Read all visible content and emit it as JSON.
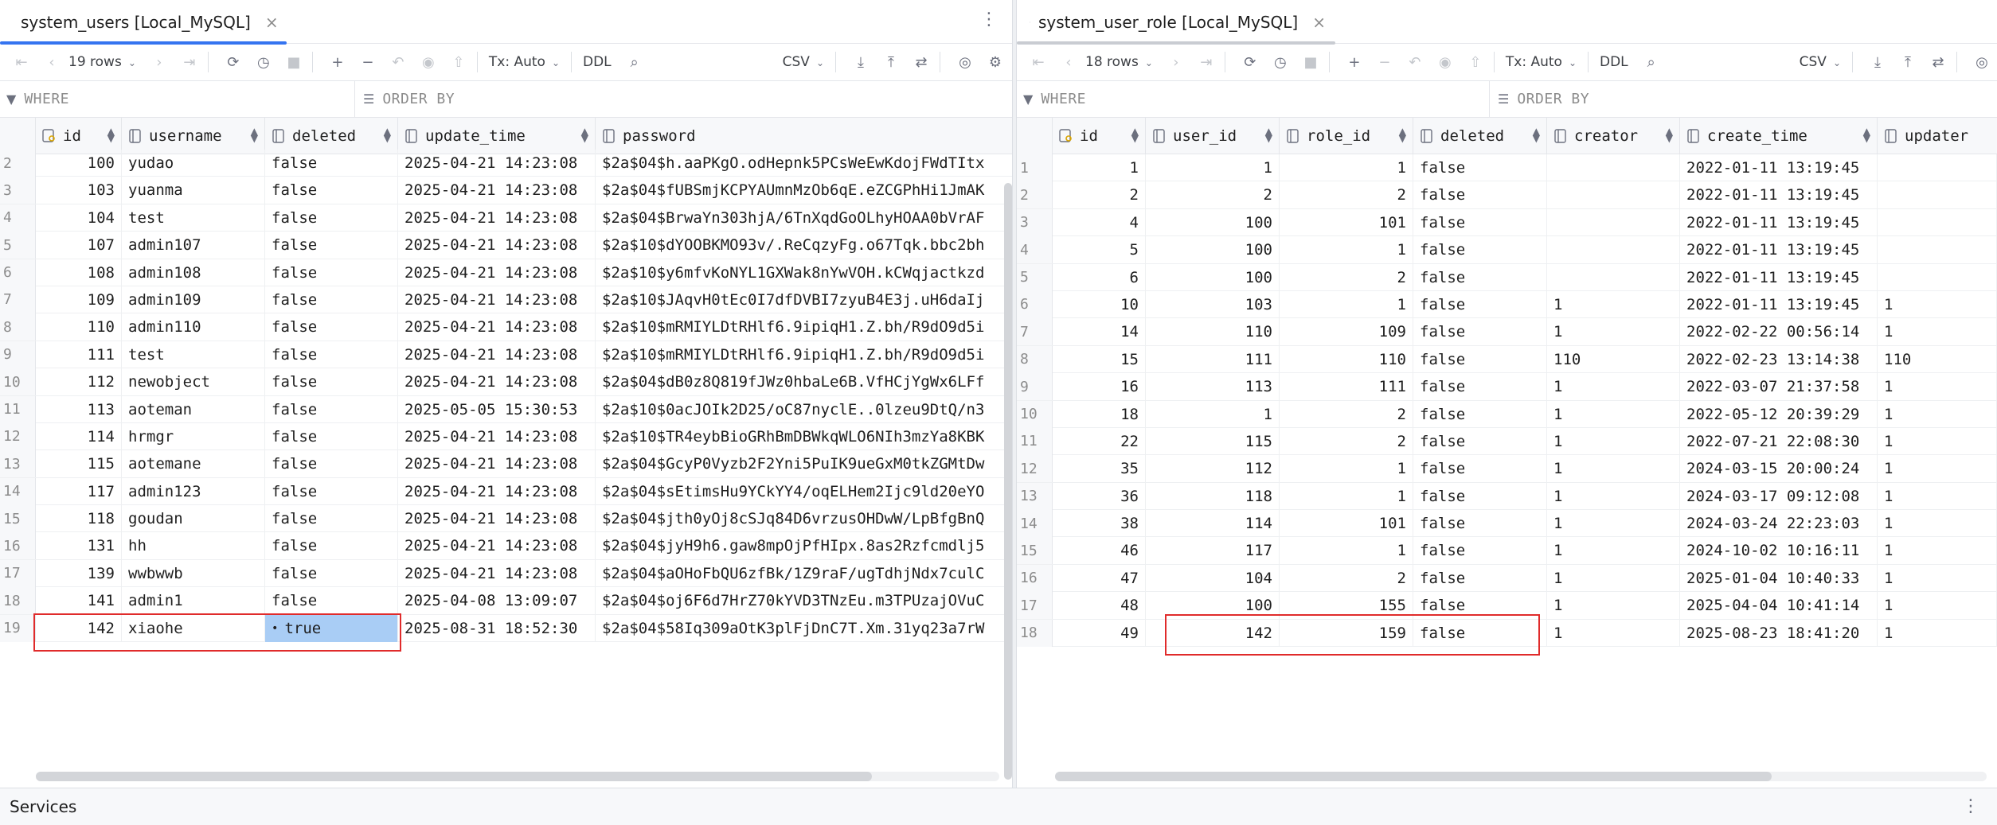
{
  "left": {
    "tab_title": "system_users [Local_MySQL]",
    "rows_label": "19 rows",
    "tx_label": "Tx: Auto",
    "ddl_label": "DDL",
    "export_format": "CSV",
    "where_label": "WHERE",
    "orderby_label": "ORDER BY",
    "columns": [
      "id",
      "username",
      "deleted",
      "update_time",
      "password"
    ],
    "rows": [
      [
        "2",
        "100",
        "yudao",
        "false",
        "2025-04-21 14:23:08",
        "$2a$04$h.aaPKgO.odHepnk5PCsWeEwKdojFWdTItx"
      ],
      [
        "3",
        "103",
        "yuanma",
        "false",
        "2025-04-21 14:23:08",
        "$2a$04$fUBSmjKCPYAUmnMzOb6qE.eZCGPhHi1JmAK"
      ],
      [
        "4",
        "104",
        "test",
        "false",
        "2025-04-21 14:23:08",
        "$2a$04$BrwaYn303hjA/6TnXqdGoOLhyHOAA0bVrAF"
      ],
      [
        "5",
        "107",
        "admin107",
        "false",
        "2025-04-21 14:23:08",
        "$2a$10$dYOOBKMO93v/.ReCqzyFg.o67Tqk.bbc2bh"
      ],
      [
        "6",
        "108",
        "admin108",
        "false",
        "2025-04-21 14:23:08",
        "$2a$10$y6mfvKoNYL1GXWak8nYwVOH.kCWqjactkzd"
      ],
      [
        "7",
        "109",
        "admin109",
        "false",
        "2025-04-21 14:23:08",
        "$2a$10$JAqvH0tEc0I7dfDVBI7zyuB4E3j.uH6daIj"
      ],
      [
        "8",
        "110",
        "admin110",
        "false",
        "2025-04-21 14:23:08",
        "$2a$10$mRMIYLDtRHlf6.9ipiqH1.Z.bh/R9dO9d5i"
      ],
      [
        "9",
        "111",
        "test",
        "false",
        "2025-04-21 14:23:08",
        "$2a$10$mRMIYLDtRHlf6.9ipiqH1.Z.bh/R9dO9d5i"
      ],
      [
        "10",
        "112",
        "newobject",
        "false",
        "2025-04-21 14:23:08",
        "$2a$04$dB0z8Q819fJWz0hbaLe6B.VfHCjYgWx6LFf"
      ],
      [
        "11",
        "113",
        "aoteman",
        "false",
        "2025-05-05 15:30:53",
        "$2a$10$0acJOIk2D25/oC87nyclE..0lzeu9DtQ/n3"
      ],
      [
        "12",
        "114",
        "hrmgr",
        "false",
        "2025-04-21 14:23:08",
        "$2a$10$TR4eybBioGRhBmDBWkqWLO6NIh3mzYa8KBK"
      ],
      [
        "13",
        "115",
        "aotemane",
        "false",
        "2025-04-21 14:23:08",
        "$2a$04$GcyP0Vyzb2F2Yni5PuIK9ueGxM0tkZGMtDw"
      ],
      [
        "14",
        "117",
        "admin123",
        "false",
        "2025-04-21 14:23:08",
        "$2a$04$sEtimsHu9YCkYY4/oqELHem2Ijc9ld20eYO"
      ],
      [
        "15",
        "118",
        "goudan",
        "false",
        "2025-04-21 14:23:08",
        "$2a$04$jth0yOj8cSJq84D6vrzusOHDwW/LpBfgBnQ"
      ],
      [
        "16",
        "131",
        "hh",
        "false",
        "2025-04-21 14:23:08",
        "$2a$04$jyH9h6.gaw8mpOjPfHIpx.8as2Rzfcmdlj5"
      ],
      [
        "17",
        "139",
        "wwbwwb",
        "false",
        "2025-04-21 14:23:08",
        "$2a$04$aOHoFbQU6zfBk/1Z9raF/ugTdhjNdx7culC"
      ],
      [
        "18",
        "141",
        "admin1",
        "false",
        "2025-04-08 13:09:07",
        "$2a$04$oj6F6d7HrZ70kYVD3TNzEu.m3TPUzajOVuC"
      ],
      [
        "19",
        "142",
        "xiaohe",
        "true",
        "2025-08-31 18:52:30",
        "$2a$04$58Iq309aOtK3plFjDnC7T.Xm.31yq23a7rW"
      ]
    ]
  },
  "right": {
    "tab_title": "system_user_role [Local_MySQL]",
    "rows_label": "18 rows",
    "tx_label": "Tx: Auto",
    "ddl_label": "DDL",
    "export_format": "CSV",
    "where_label": "WHERE",
    "orderby_label": "ORDER BY",
    "columns": [
      "id",
      "user_id",
      "role_id",
      "deleted",
      "creator",
      "create_time",
      "updater"
    ],
    "rows": [
      [
        "1",
        "1",
        "1",
        "1",
        "false",
        "",
        "2022-01-11 13:19:45",
        ""
      ],
      [
        "2",
        "2",
        "2",
        "2",
        "false",
        "",
        "2022-01-11 13:19:45",
        ""
      ],
      [
        "3",
        "4",
        "100",
        "101",
        "false",
        "",
        "2022-01-11 13:19:45",
        ""
      ],
      [
        "4",
        "5",
        "100",
        "1",
        "false",
        "",
        "2022-01-11 13:19:45",
        ""
      ],
      [
        "5",
        "6",
        "100",
        "2",
        "false",
        "",
        "2022-01-11 13:19:45",
        ""
      ],
      [
        "6",
        "10",
        "103",
        "1",
        "false",
        "1",
        "2022-01-11 13:19:45",
        "1"
      ],
      [
        "7",
        "14",
        "110",
        "109",
        "false",
        "1",
        "2022-02-22 00:56:14",
        "1"
      ],
      [
        "8",
        "15",
        "111",
        "110",
        "false",
        "110",
        "2022-02-23 13:14:38",
        "110"
      ],
      [
        "9",
        "16",
        "113",
        "111",
        "false",
        "1",
        "2022-03-07 21:37:58",
        "1"
      ],
      [
        "10",
        "18",
        "1",
        "2",
        "false",
        "1",
        "2022-05-12 20:39:29",
        "1"
      ],
      [
        "11",
        "22",
        "115",
        "2",
        "false",
        "1",
        "2022-07-21 22:08:30",
        "1"
      ],
      [
        "12",
        "35",
        "112",
        "1",
        "false",
        "1",
        "2024-03-15 20:00:24",
        "1"
      ],
      [
        "13",
        "36",
        "118",
        "1",
        "false",
        "1",
        "2024-03-17 09:12:08",
        "1"
      ],
      [
        "14",
        "38",
        "114",
        "101",
        "false",
        "1",
        "2024-03-24 22:23:03",
        "1"
      ],
      [
        "15",
        "46",
        "117",
        "1",
        "false",
        "1",
        "2024-10-02 10:16:11",
        "1"
      ],
      [
        "16",
        "47",
        "104",
        "2",
        "false",
        "1",
        "2025-01-04 10:40:33",
        "1"
      ],
      [
        "17",
        "48",
        "100",
        "155",
        "false",
        "1",
        "2025-04-04 10:41:14",
        "1"
      ],
      [
        "18",
        "49",
        "142",
        "159",
        "false",
        "1",
        "2025-08-23 18:41:20",
        "1"
      ]
    ]
  },
  "services_label": "Services",
  "colors": {
    "accent": "#3574f0",
    "selection": "#a9cdf5",
    "highlight_box": "#e02b2b"
  }
}
